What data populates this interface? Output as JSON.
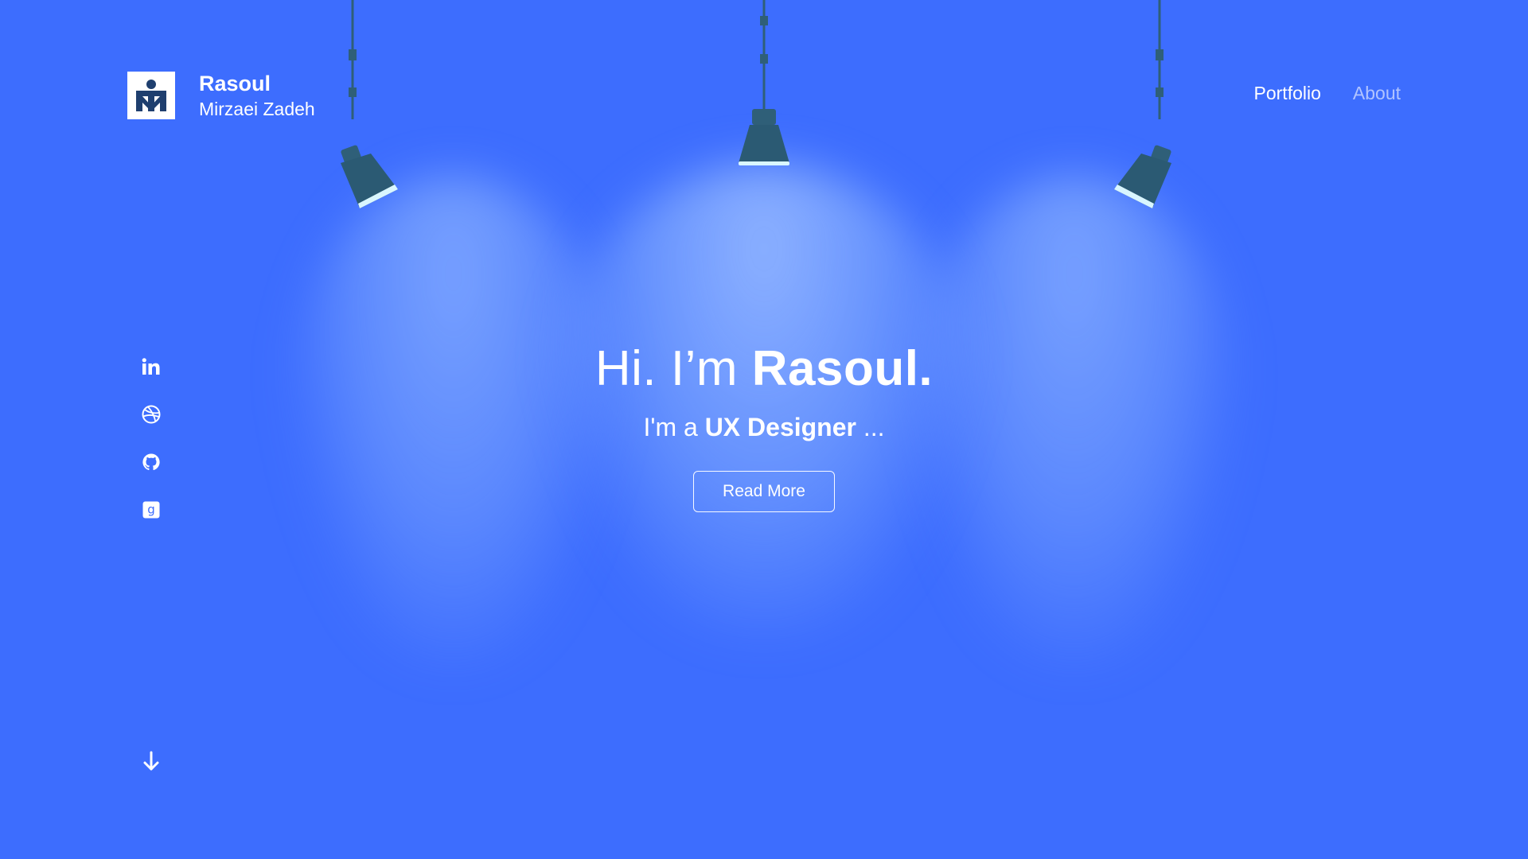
{
  "header": {
    "brand_first": "Rasoul",
    "brand_last": "Mirzaei Zadeh",
    "nav": [
      {
        "label": "Portfolio",
        "active": true
      },
      {
        "label": "About",
        "active": false
      }
    ]
  },
  "hero": {
    "greeting": "Hi. I’m ",
    "name": "Rasoul.",
    "sub_prefix": "I'm a ",
    "role": "UX Designer",
    "sub_suffix": " ...",
    "cta_label": "Read More"
  },
  "social": [
    {
      "name": "linkedin-icon",
      "glyph": "in"
    },
    {
      "name": "dribbble-icon"
    },
    {
      "name": "github-icon"
    },
    {
      "name": "goodreads-icon",
      "glyph": "g"
    }
  ],
  "colors": {
    "background": "#3d6dfe",
    "lamp": "#2f5f78",
    "text": "#ffffff"
  },
  "icons": {
    "scroll": "arrow-down-icon",
    "logo": "rmz-logo"
  }
}
